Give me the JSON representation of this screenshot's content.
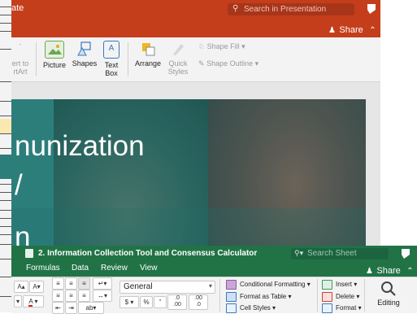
{
  "powerpoint": {
    "title_fragment": "ate",
    "search_placeholder": "Search in Presentation",
    "share_label": "Share",
    "ribbon": {
      "convert_line1": "ert to",
      "convert_line2": "rtArt",
      "picture": "Picture",
      "shapes": "Shapes",
      "text_box_line1": "Text",
      "text_box_line2": "Box",
      "arrange": "Arrange",
      "quick_styles_line1": "Quick",
      "quick_styles_line2": "Styles",
      "shape_fill": "Shape Fill",
      "shape_outline": "Shape Outline"
    },
    "slide": {
      "line1": "nunization",
      "line2": "/",
      "line3": "n"
    }
  },
  "excel": {
    "title": "2. Information Collection Tool and Consensus Calculator",
    "search_placeholder": "Search Sheet",
    "share_label": "Share",
    "tabs": [
      "Formulas",
      "Data",
      "Review",
      "View"
    ],
    "number_format": "General",
    "currency_symbol": "$",
    "percent_symbol": "%",
    "comma_symbol": "’",
    "increase_decimal": ".0\n.00",
    "decrease_decimal": ".00\n.0",
    "conditional_formatting": "Conditional Formatting",
    "format_as_table": "Format as Table",
    "cell_styles": "Cell Styles",
    "insert": "Insert",
    "delete": "Delete",
    "format": "Format",
    "editing": "Editing",
    "font_grow": "A",
    "font_shrink": "A",
    "font_color": "A"
  },
  "colors": {
    "powerpoint_accent": "#c43e1c",
    "excel_accent": "#217346",
    "slide_teal": "#2c7e7b"
  }
}
